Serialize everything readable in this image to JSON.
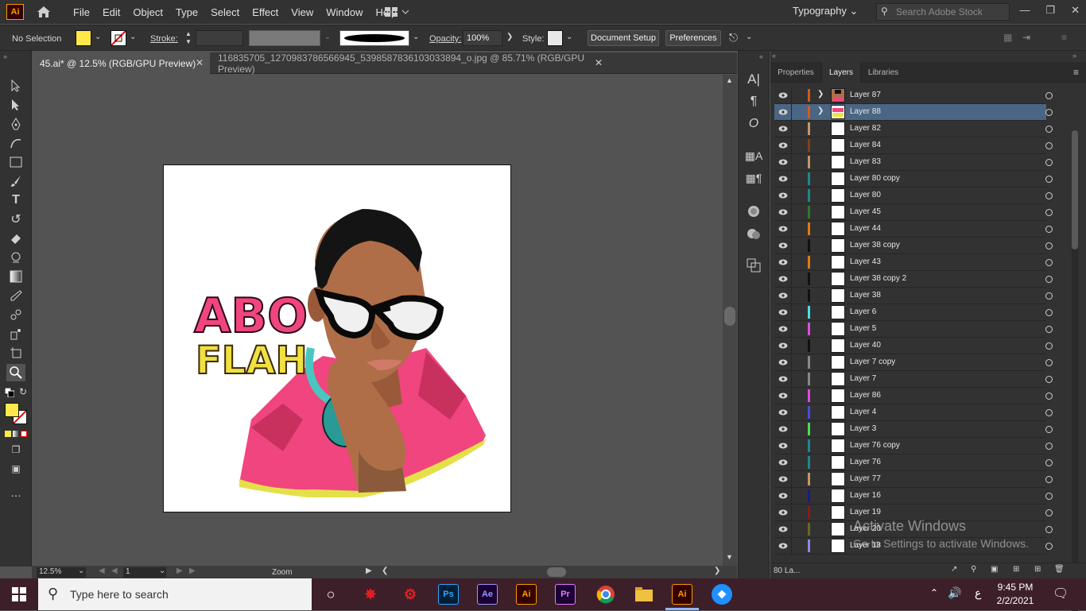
{
  "app": {
    "logo_text": "Ai"
  },
  "menu": [
    "File",
    "Edit",
    "Object",
    "Type",
    "Select",
    "Effect",
    "View",
    "Window",
    "Help"
  ],
  "workspace": "Typography",
  "search_placeholder": "Search Adobe Stock",
  "control": {
    "selection": "No Selection",
    "stroke_label": "Stroke:",
    "opacity_label": "Opacity:",
    "opacity_value": "100%",
    "style_label": "Style:",
    "document_setup": "Document Setup",
    "preferences": "Preferences",
    "fill_color": "#ffe94a"
  },
  "tabs": [
    {
      "label": "45.ai* @ 12.5% (RGB/GPU Preview)",
      "active": true
    },
    {
      "label": "116835705_1270983786566945_5398587836103033894_o.jpg @ 85.71% (RGB/GPU Preview)",
      "active": false
    }
  ],
  "artwork": {
    "title_line1": "ABO",
    "title_line2": "FLAH"
  },
  "status": {
    "zoom": "12.5%",
    "page": "1",
    "tool": "Zoom"
  },
  "panel": {
    "tabs": [
      "Properties",
      "Layers",
      "Libraries"
    ],
    "active_tab": "Layers",
    "footer_count": "80 La...",
    "layers": [
      {
        "name": "Layer 87",
        "color": "#d35a1a",
        "expand": true,
        "thumb": "art"
      },
      {
        "name": "Layer 88",
        "color": "#d35a1a",
        "expand": true,
        "thumb": "logo",
        "selected": true
      },
      {
        "name": "Layer 82",
        "color": "#c4956a"
      },
      {
        "name": "Layer 84",
        "color": "#8b3a1a"
      },
      {
        "name": "Layer 83",
        "color": "#c4956a"
      },
      {
        "name": "Layer 80 copy",
        "color": "#1a8a8a"
      },
      {
        "name": "Layer 80",
        "color": "#1a8a8a"
      },
      {
        "name": "Layer 45",
        "color": "#2a7a2a"
      },
      {
        "name": "Layer 44",
        "color": "#e07a10"
      },
      {
        "name": "Layer 38 copy",
        "color": "#111111"
      },
      {
        "name": "Layer 43",
        "color": "#e07a10"
      },
      {
        "name": "Layer 38 copy 2",
        "color": "#111111"
      },
      {
        "name": "Layer 38",
        "color": "#111111"
      },
      {
        "name": "Layer 6",
        "color": "#4ae0e0"
      },
      {
        "name": "Layer 5",
        "color": "#e04ae0"
      },
      {
        "name": "Layer 40",
        "color": "#111111"
      },
      {
        "name": "Layer 7 copy",
        "color": "#888888"
      },
      {
        "name": "Layer 7",
        "color": "#888888"
      },
      {
        "name": "Layer 86",
        "color": "#e04ae0"
      },
      {
        "name": "Layer 4",
        "color": "#4a4ae0"
      },
      {
        "name": "Layer 3",
        "color": "#4ae04a"
      },
      {
        "name": "Layer 76 copy",
        "color": "#1a8a8a"
      },
      {
        "name": "Layer 76",
        "color": "#1a8a8a"
      },
      {
        "name": "Layer 77",
        "color": "#c4956a"
      },
      {
        "name": "Layer 16",
        "color": "#1a1a8a"
      },
      {
        "name": "Layer 19",
        "color": "#8a1a1a"
      },
      {
        "name": "Layer 20",
        "color": "#6a6a1a"
      },
      {
        "name": "Layer 18",
        "color": "#8a8ae0"
      }
    ]
  },
  "watermark": {
    "line1": "Activate Windows",
    "line2": "Go to Settings to activate Windows."
  },
  "taskbar": {
    "search_placeholder": "Type here to search",
    "apps": [
      {
        "label": "Ps",
        "color": "#001e36",
        "fg": "#31a8ff"
      },
      {
        "label": "Ae",
        "color": "#1a0033",
        "fg": "#9999ff"
      },
      {
        "label": "Ai",
        "color": "#330000",
        "fg": "#ff9a00"
      },
      {
        "label": "Pr",
        "color": "#1a0033",
        "fg": "#e579ff"
      }
    ],
    "time": "9:45 PM",
    "date": "2/2/2021",
    "lang": "ع"
  }
}
